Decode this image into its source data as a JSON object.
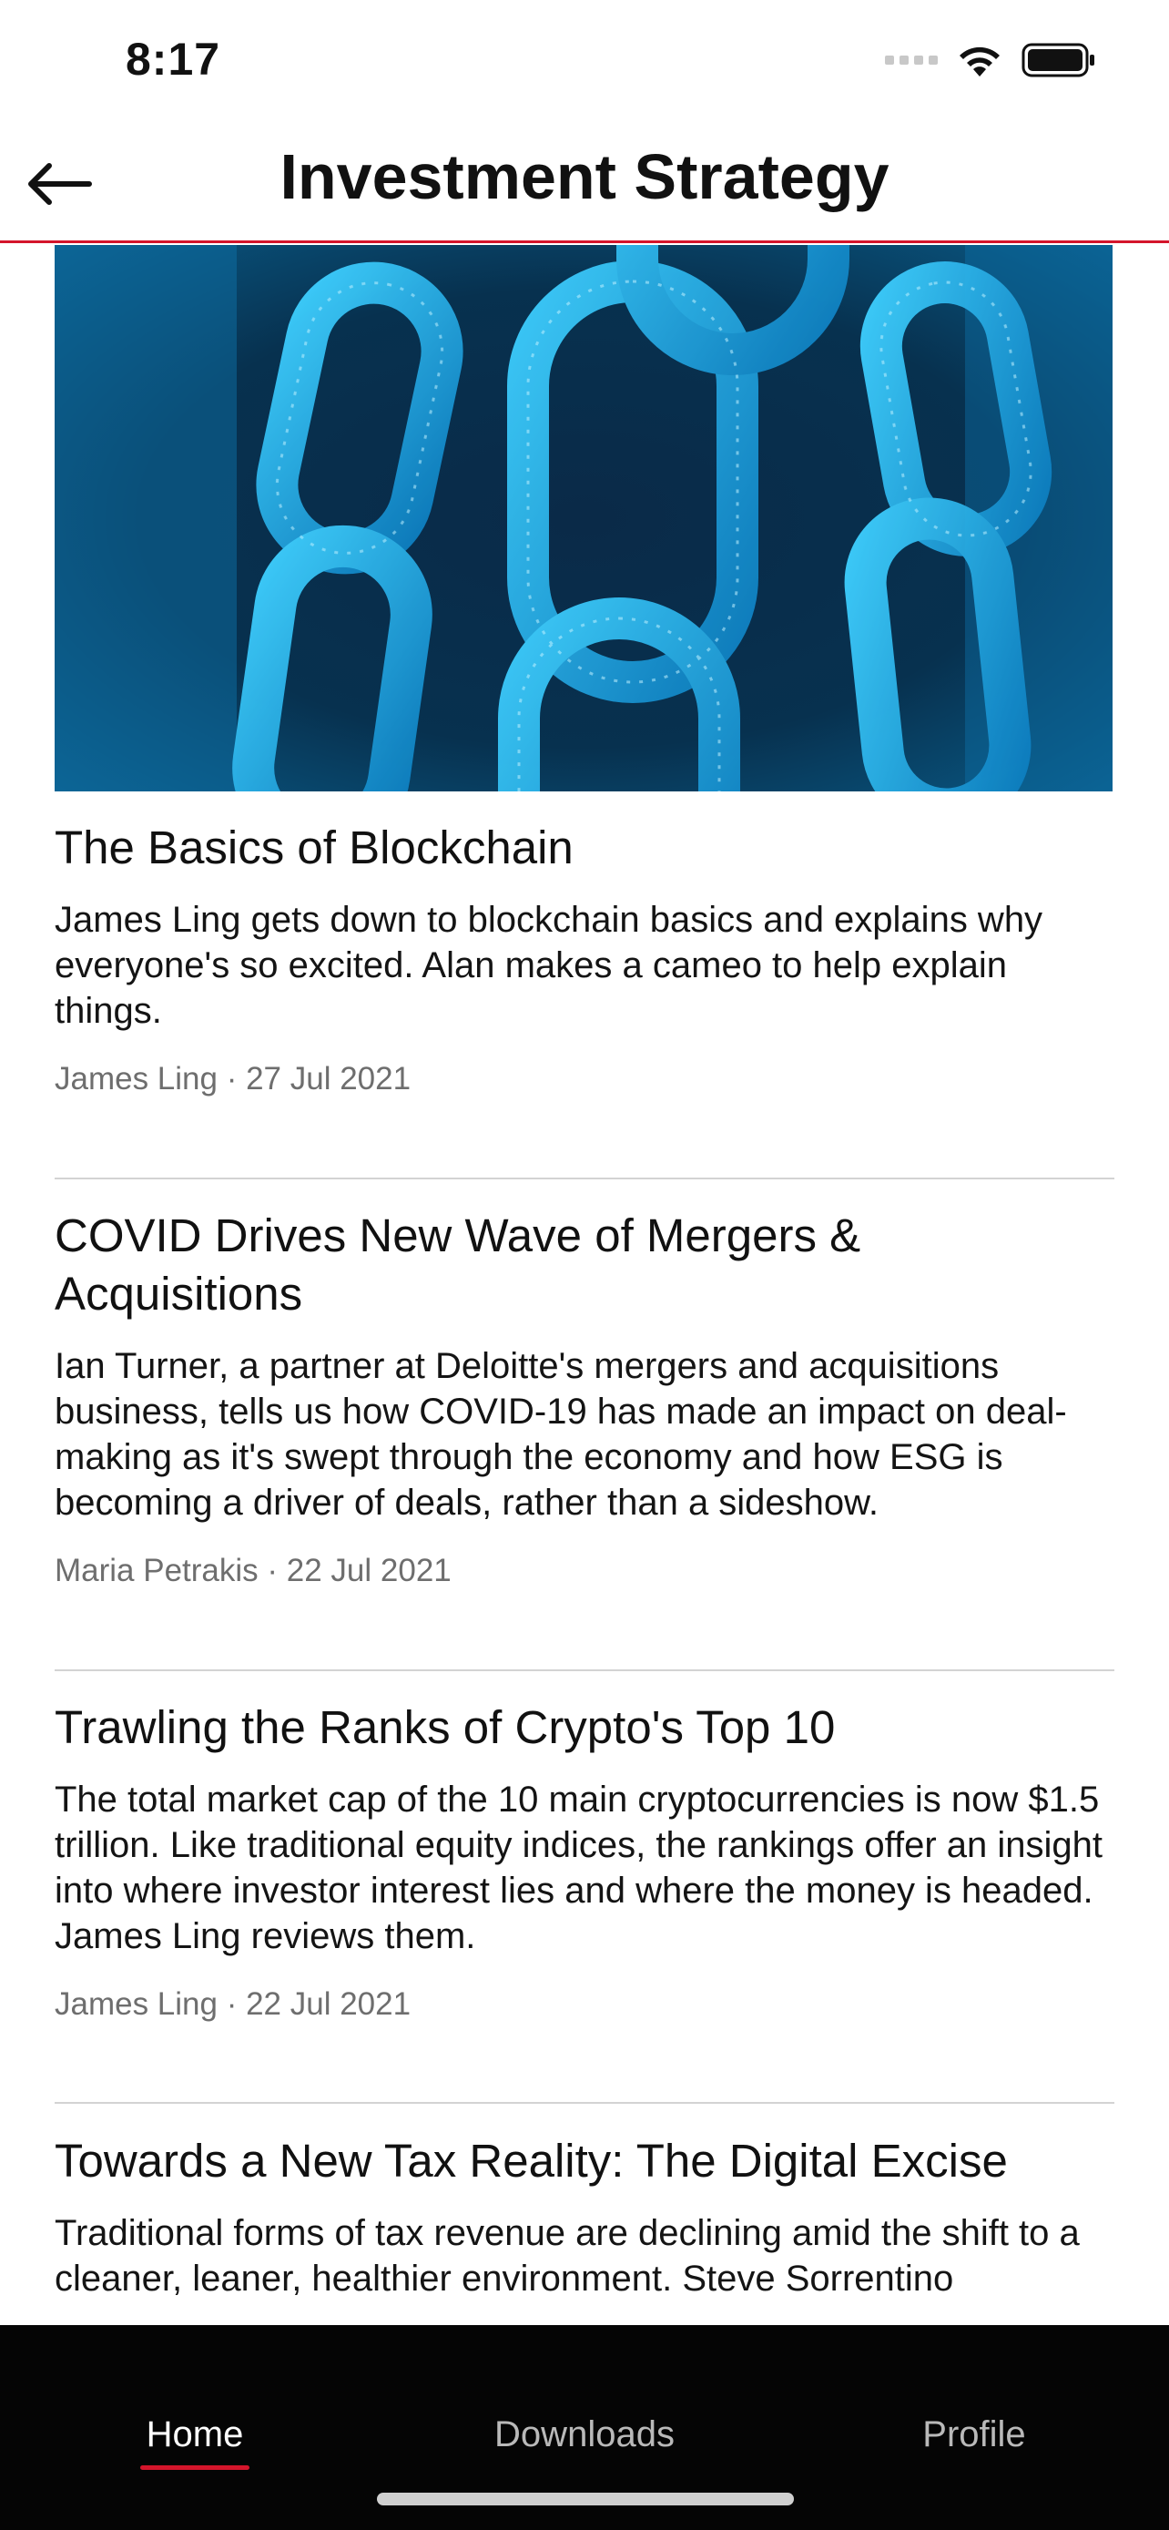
{
  "status_bar": {
    "time": "8:17"
  },
  "header": {
    "title": "Investment Strategy"
  },
  "articles": [
    {
      "title": "The Basics of Blockchain",
      "summary": "James Ling gets down to blockchain basics and explains why everyone's so excited. Alan makes a cameo to help explain things.",
      "meta": "James Ling · 27 Jul 2021"
    },
    {
      "title": "COVID Drives New Wave of Mergers & Acquisitions",
      "summary": "Ian Turner, a partner at Deloitte's mergers and acquisitions business, tells us how COVID-19 has made an impact on deal-making as it's swept through the economy and how ESG is becoming a driver of deals, rather than a sideshow.",
      "meta": "Maria Petrakis · 22 Jul 2021"
    },
    {
      "title": "Trawling the Ranks of Crypto's Top 10",
      "summary": "The total market cap of the 10 main cryptocurrencies is now $1.5 trillion. Like traditional equity indices, the rankings offer an insight into where investor interest lies and where the money is headed. James Ling reviews them.",
      "meta": "James Ling · 22 Jul 2021"
    },
    {
      "title": "Towards a New Tax Reality: The Digital Excise",
      "summary": "Traditional forms of tax revenue are declining amid the shift to a cleaner, leaner, healthier environment. Steve Sorrentino"
    }
  ],
  "tabs": [
    {
      "label": "Home",
      "active": true
    },
    {
      "label": "Downloads",
      "active": false
    },
    {
      "label": "Profile",
      "active": false
    }
  ],
  "colors": {
    "accent": "#d4152b",
    "tab_bar_bg": "#050505"
  },
  "icons": {
    "back": "arrow-left-icon",
    "wifi": "wifi-icon",
    "battery": "battery-icon",
    "signal": "signal-icon",
    "hero": "blockchain-chain-image"
  }
}
